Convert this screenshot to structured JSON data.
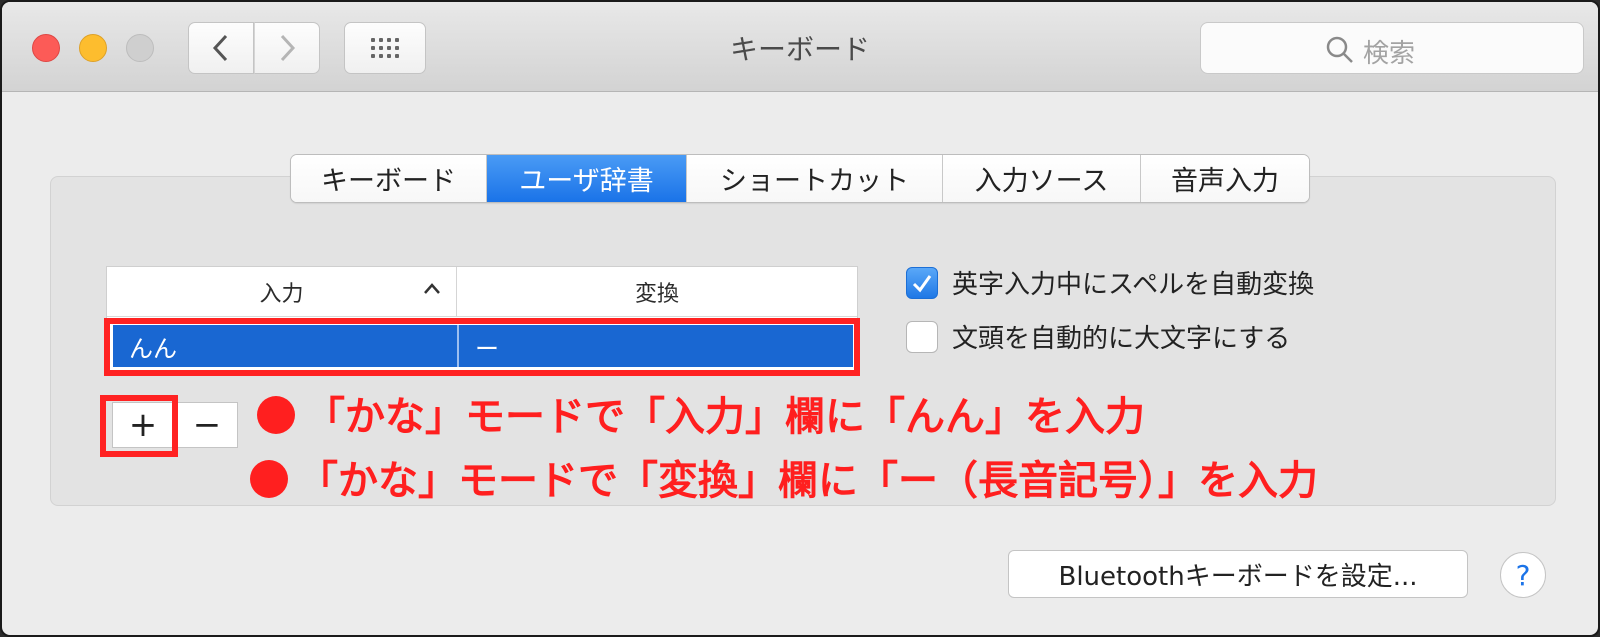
{
  "window": {
    "title": "キーボード"
  },
  "toolbar": {
    "search_placeholder": "検索"
  },
  "tabs": [
    {
      "label": "キーボード",
      "active": false
    },
    {
      "label": "ユーザ辞書",
      "active": true
    },
    {
      "label": "ショートカット",
      "active": false
    },
    {
      "label": "入力ソース",
      "active": false
    },
    {
      "label": "音声入力",
      "active": false
    }
  ],
  "dictionary": {
    "columns": [
      "入力",
      "変換"
    ],
    "rows": [
      {
        "input": "んん",
        "output": "ー"
      }
    ],
    "add_label": "+",
    "remove_label": "−"
  },
  "options": [
    {
      "label": "英字入力中にスペルを自動変換",
      "checked": true
    },
    {
      "label": "文頭を自動的に大文字にする",
      "checked": false
    }
  ],
  "annotations": [
    "「かな」モードで「入力」欄に「んん」を入力",
    "「かな」モードで「変換」欄に「ー（長音記号）」を入力"
  ],
  "footer": {
    "bluetooth_button": "Bluetoothキーボードを設定...",
    "help_label": "?"
  },
  "colors": {
    "accent": "#1967d2",
    "annotation": "#ff1f1f"
  }
}
